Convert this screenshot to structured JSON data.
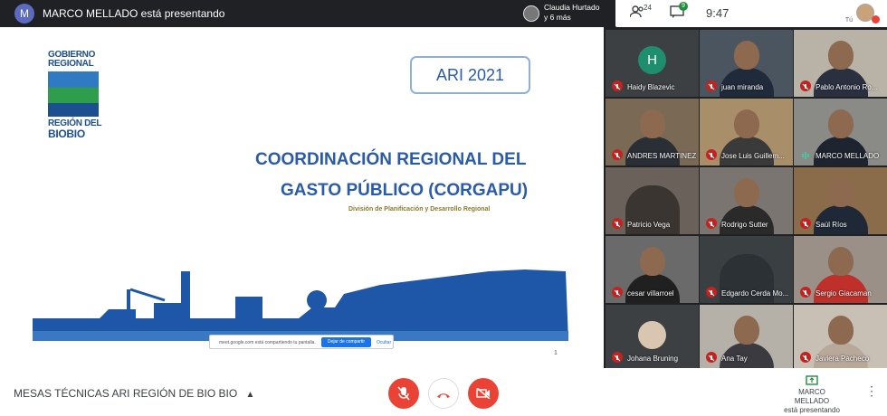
{
  "topbar": {
    "presenter_initial": "M",
    "presenting_text": "MARCO MELLADO está presentando",
    "people_line1": "Claudia Hurtado",
    "people_line2": "y 6 más",
    "participants_count": "24",
    "chat_count": "9",
    "time": "9:47",
    "self_label": "Tú"
  },
  "slide": {
    "logo_line1": "GOBIERNO",
    "logo_line2": "REGIONAL",
    "logo_line3": "REGIÓN DEL",
    "logo_line4": "BIOBIO",
    "ari_label": "ARI 2021",
    "title_line1": "COORDINACIÓN REGIONAL DEL",
    "title_line2": "GASTO PÚBLICO (CORGAPU)",
    "subtitle": "División de Planificación y Desarrollo Regional",
    "share_text": "meet.google.com está compartiendo tu pantalla.",
    "stop_share": "Dejar de compartir",
    "hide": "Ocultar",
    "page_number": "1"
  },
  "participants": [
    {
      "name": "Haidy Blazevic",
      "initial": "H",
      "video": false,
      "muted": true
    },
    {
      "name": "juan miranda",
      "video": true,
      "muted": true,
      "bg": "#4a5560",
      "shirt": "#1f2a3a"
    },
    {
      "name": "Pablo Antonio Ro...",
      "video": true,
      "muted": true,
      "bg": "#b8b3a6",
      "shirt": "#2a3040"
    },
    {
      "name": "ANDRES MARTINEZ",
      "video": true,
      "muted": true,
      "bg": "#7a6a55",
      "shirt": "#2a2f36"
    },
    {
      "name": "Jose Luis Guillem...",
      "video": true,
      "muted": true,
      "bg": "#a88f6a",
      "shirt": "#3a3a3a"
    },
    {
      "name": "MARCO MELLADO",
      "video": true,
      "muted": false,
      "bg": "#8a8a86",
      "shirt": "#1d2430"
    },
    {
      "name": "Patricio Vega",
      "video": true,
      "muted": true,
      "bg": "#6a625a",
      "shirt": "#3a3530",
      "noface": true
    },
    {
      "name": "Rodrigo Sutter",
      "video": true,
      "muted": true,
      "bg": "#7a7570",
      "shirt": "#2a2a2a"
    },
    {
      "name": "Saúl Ríos",
      "video": true,
      "muted": true,
      "bg": "#8a6b4a",
      "shirt": "#1e2836"
    },
    {
      "name": "cesar villarroel",
      "video": true,
      "muted": true,
      "bg": "#6b6a6a",
      "shirt": "#202020"
    },
    {
      "name": "Edgardo Cerda Mo...",
      "video": true,
      "muted": true,
      "bg": "#3a3f42",
      "shirt": "#2c3136",
      "noface": true
    },
    {
      "name": "Sergio Giacaman",
      "video": true,
      "muted": true,
      "bg": "#9a9088",
      "shirt": "#c0302a"
    },
    {
      "name": "Johana Bruning",
      "video": false,
      "muted": true,
      "avatar": true
    },
    {
      "name": "Ana Tay",
      "video": true,
      "muted": true,
      "bg": "#b5b0a8",
      "shirt": "#3a3a40"
    },
    {
      "name": "Javiera Pacheco",
      "video": true,
      "muted": true,
      "bg": "#c8c0b5",
      "shirt": "#b8a89a"
    }
  ],
  "bottombar": {
    "meeting_title": "MESAS TÉCNICAS ARI REGIÓN DE BIO BIO",
    "present_line1": "MARCO MELLADO",
    "present_line2": "está presentando"
  },
  "colors": {
    "danger": "#ea4335",
    "brand_blue": "#2a5ba8"
  }
}
